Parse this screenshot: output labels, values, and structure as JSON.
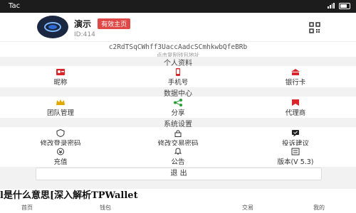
{
  "status_bar": {
    "time": "Tac"
  },
  "header": {
    "app_name": "演示",
    "badge": "有效主页",
    "id_text": "ID:414",
    "qr_icon": "qr-code-icon"
  },
  "address": {
    "value": "c2RdTSqCWhff3UaccAadcSCmhkwbQfeBRb",
    "hint": "点击复制钱包地址"
  },
  "sections": {
    "personal": "个人资料",
    "data": "数据中心",
    "system": "系统设置"
  },
  "personal_items": [
    {
      "label": "昵称",
      "icon": "id-card-icon",
      "color": "#d9262b"
    },
    {
      "label": "手机号",
      "icon": "phone-icon",
      "color": "#d9262b"
    },
    {
      "label": "银行卡",
      "icon": "bank-card-icon",
      "color": "#d9262b"
    }
  ],
  "data_items": [
    {
      "label": "团队管理",
      "icon": "crown-icon",
      "color": "#e0a800"
    },
    {
      "label": "分享",
      "icon": "share-icon",
      "color": "#2a9c3a"
    },
    {
      "label": "代理商",
      "icon": "agent-icon",
      "color": "#d9262b"
    }
  ],
  "system_items_row1": [
    {
      "label": "修改登录密码",
      "icon": "shield-icon"
    },
    {
      "label": "修改交易密码",
      "icon": "lock-icon"
    },
    {
      "label": "投诉建议",
      "icon": "feedback-icon"
    }
  ],
  "system_items_row2": [
    {
      "label": "充值",
      "icon": "recharge-icon"
    },
    {
      "label": "公告",
      "icon": "bell-icon"
    },
    {
      "label": "版本(V 5.3)",
      "icon": "version-icon"
    }
  ],
  "logout_label": "退 出",
  "overlay_text": "l是什么意思[深入解析TPWallet",
  "bottom_nav": [
    "首页",
    "钱包",
    "交易",
    "我的"
  ]
}
